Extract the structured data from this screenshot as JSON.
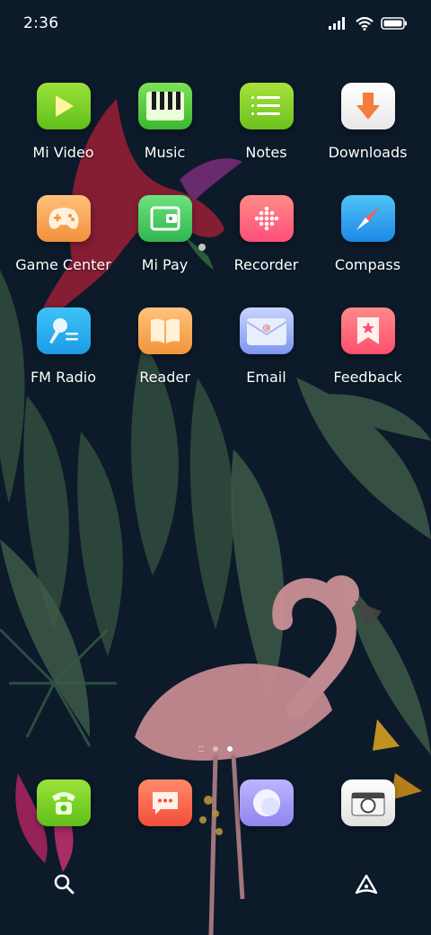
{
  "status_bar": {
    "time": "2:36",
    "icons": [
      "signal-icon",
      "wifi-icon",
      "battery-icon"
    ]
  },
  "apps": [
    {
      "label": "Mi Video",
      "icon": "play-icon",
      "color": "#7ed321"
    },
    {
      "label": "Music",
      "icon": "piano-icon",
      "color": "#5fce44"
    },
    {
      "label": "Notes",
      "icon": "list-icon",
      "color": "#8ad62a"
    },
    {
      "label": "Downloads",
      "icon": "download-arrow-icon",
      "color": "#f5f5f5"
    },
    {
      "label": "Game Center",
      "icon": "gamepad-icon",
      "color": "#f8a860"
    },
    {
      "label": "Mi Pay",
      "icon": "wallet-icon",
      "color": "#3ec85a"
    },
    {
      "label": "Recorder",
      "icon": "dots-grid-icon",
      "color": "#ff6b7e"
    },
    {
      "label": "Compass",
      "icon": "compass-needle-icon",
      "color": "#2ea7f0"
    },
    {
      "label": "FM Radio",
      "icon": "microphone-icon",
      "color": "#27b0f0"
    },
    {
      "label": "Reader",
      "icon": "open-book-icon",
      "color": "#f7a848"
    },
    {
      "label": "Email",
      "icon": "envelope-icon",
      "color": "#8fa7f5"
    },
    {
      "label": "Feedback",
      "icon": "bookmark-star-icon",
      "color": "#ff5e7a"
    }
  ],
  "dock": [
    {
      "name": "phone",
      "icon": "phone-icon",
      "color": "#7ed321"
    },
    {
      "name": "messaging",
      "icon": "chat-bubble-icon",
      "color": "#ff6a55"
    },
    {
      "name": "browser",
      "icon": "browser-orb-icon",
      "color": "#9f97f2"
    },
    {
      "name": "camera",
      "icon": "camera-icon",
      "color": "#f2f2f2"
    }
  ],
  "page_indicator": {
    "pages": 2,
    "active_index": 1
  },
  "bottom_bar": {
    "left": "search-icon",
    "right": "assistant-icon"
  }
}
